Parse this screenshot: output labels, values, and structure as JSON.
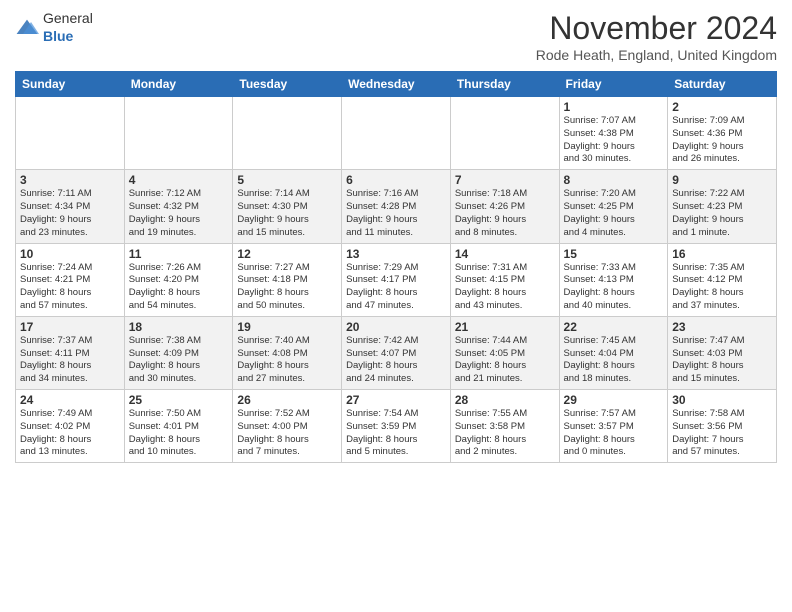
{
  "header": {
    "logo": {
      "text1": "General",
      "text2": "Blue"
    },
    "title": "November 2024",
    "subtitle": "Rode Heath, England, United Kingdom"
  },
  "calendar": {
    "days_of_week": [
      "Sunday",
      "Monday",
      "Tuesday",
      "Wednesday",
      "Thursday",
      "Friday",
      "Saturday"
    ],
    "rows": [
      {
        "cells": [
          {
            "day": "",
            "info": ""
          },
          {
            "day": "",
            "info": ""
          },
          {
            "day": "",
            "info": ""
          },
          {
            "day": "",
            "info": ""
          },
          {
            "day": "",
            "info": ""
          },
          {
            "day": "1",
            "info": "Sunrise: 7:07 AM\nSunset: 4:38 PM\nDaylight: 9 hours\nand 30 minutes."
          },
          {
            "day": "2",
            "info": "Sunrise: 7:09 AM\nSunset: 4:36 PM\nDaylight: 9 hours\nand 26 minutes."
          }
        ]
      },
      {
        "cells": [
          {
            "day": "3",
            "info": "Sunrise: 7:11 AM\nSunset: 4:34 PM\nDaylight: 9 hours\nand 23 minutes."
          },
          {
            "day": "4",
            "info": "Sunrise: 7:12 AM\nSunset: 4:32 PM\nDaylight: 9 hours\nand 19 minutes."
          },
          {
            "day": "5",
            "info": "Sunrise: 7:14 AM\nSunset: 4:30 PM\nDaylight: 9 hours\nand 15 minutes."
          },
          {
            "day": "6",
            "info": "Sunrise: 7:16 AM\nSunset: 4:28 PM\nDaylight: 9 hours\nand 11 minutes."
          },
          {
            "day": "7",
            "info": "Sunrise: 7:18 AM\nSunset: 4:26 PM\nDaylight: 9 hours\nand 8 minutes."
          },
          {
            "day": "8",
            "info": "Sunrise: 7:20 AM\nSunset: 4:25 PM\nDaylight: 9 hours\nand 4 minutes."
          },
          {
            "day": "9",
            "info": "Sunrise: 7:22 AM\nSunset: 4:23 PM\nDaylight: 9 hours\nand 1 minute."
          }
        ]
      },
      {
        "cells": [
          {
            "day": "10",
            "info": "Sunrise: 7:24 AM\nSunset: 4:21 PM\nDaylight: 8 hours\nand 57 minutes."
          },
          {
            "day": "11",
            "info": "Sunrise: 7:26 AM\nSunset: 4:20 PM\nDaylight: 8 hours\nand 54 minutes."
          },
          {
            "day": "12",
            "info": "Sunrise: 7:27 AM\nSunset: 4:18 PM\nDaylight: 8 hours\nand 50 minutes."
          },
          {
            "day": "13",
            "info": "Sunrise: 7:29 AM\nSunset: 4:17 PM\nDaylight: 8 hours\nand 47 minutes."
          },
          {
            "day": "14",
            "info": "Sunrise: 7:31 AM\nSunset: 4:15 PM\nDaylight: 8 hours\nand 43 minutes."
          },
          {
            "day": "15",
            "info": "Sunrise: 7:33 AM\nSunset: 4:13 PM\nDaylight: 8 hours\nand 40 minutes."
          },
          {
            "day": "16",
            "info": "Sunrise: 7:35 AM\nSunset: 4:12 PM\nDaylight: 8 hours\nand 37 minutes."
          }
        ]
      },
      {
        "cells": [
          {
            "day": "17",
            "info": "Sunrise: 7:37 AM\nSunset: 4:11 PM\nDaylight: 8 hours\nand 34 minutes."
          },
          {
            "day": "18",
            "info": "Sunrise: 7:38 AM\nSunset: 4:09 PM\nDaylight: 8 hours\nand 30 minutes."
          },
          {
            "day": "19",
            "info": "Sunrise: 7:40 AM\nSunset: 4:08 PM\nDaylight: 8 hours\nand 27 minutes."
          },
          {
            "day": "20",
            "info": "Sunrise: 7:42 AM\nSunset: 4:07 PM\nDaylight: 8 hours\nand 24 minutes."
          },
          {
            "day": "21",
            "info": "Sunrise: 7:44 AM\nSunset: 4:05 PM\nDaylight: 8 hours\nand 21 minutes."
          },
          {
            "day": "22",
            "info": "Sunrise: 7:45 AM\nSunset: 4:04 PM\nDaylight: 8 hours\nand 18 minutes."
          },
          {
            "day": "23",
            "info": "Sunrise: 7:47 AM\nSunset: 4:03 PM\nDaylight: 8 hours\nand 15 minutes."
          }
        ]
      },
      {
        "cells": [
          {
            "day": "24",
            "info": "Sunrise: 7:49 AM\nSunset: 4:02 PM\nDaylight: 8 hours\nand 13 minutes."
          },
          {
            "day": "25",
            "info": "Sunrise: 7:50 AM\nSunset: 4:01 PM\nDaylight: 8 hours\nand 10 minutes."
          },
          {
            "day": "26",
            "info": "Sunrise: 7:52 AM\nSunset: 4:00 PM\nDaylight: 8 hours\nand 7 minutes."
          },
          {
            "day": "27",
            "info": "Sunrise: 7:54 AM\nSunset: 3:59 PM\nDaylight: 8 hours\nand 5 minutes."
          },
          {
            "day": "28",
            "info": "Sunrise: 7:55 AM\nSunset: 3:58 PM\nDaylight: 8 hours\nand 2 minutes."
          },
          {
            "day": "29",
            "info": "Sunrise: 7:57 AM\nSunset: 3:57 PM\nDaylight: 8 hours\nand 0 minutes."
          },
          {
            "day": "30",
            "info": "Sunrise: 7:58 AM\nSunset: 3:56 PM\nDaylight: 7 hours\nand 57 minutes."
          }
        ]
      }
    ]
  }
}
